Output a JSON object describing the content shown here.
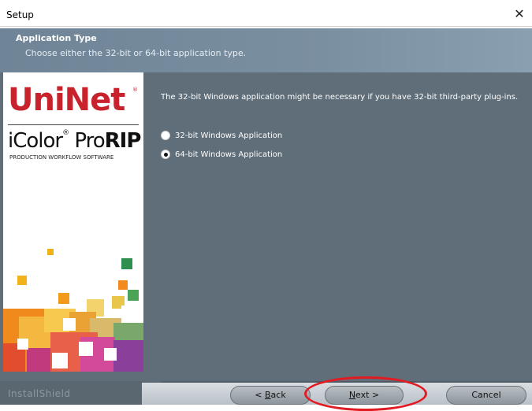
{
  "window": {
    "title": "Setup"
  },
  "header": {
    "title": "Application Type",
    "subtitle": "Choose either the 32-bit or 64-bit application type."
  },
  "side_logo": {
    "brand": "UniNet",
    "product_light": "iColor",
    "product_mid": "Pro",
    "product_bold": "RIP",
    "tagline": "PRODUCTION WORKFLOW SOFTWARE"
  },
  "content": {
    "description": "The 32-bit Windows application might be necessary if you have 32-bit third-party plug-ins.",
    "options": [
      {
        "label": "32-bit Windows Application",
        "selected": false
      },
      {
        "label": "64-bit Windows Application",
        "selected": true
      }
    ]
  },
  "footer": {
    "brand": "InstallShield",
    "back_prefix": "< ",
    "back_hot": "B",
    "back_rest": "ack",
    "next_hot": "N",
    "next_rest": "ext >",
    "cancel_label": "Cancel"
  },
  "colors": {
    "brand_red": "#c8232c",
    "panel": "#5f6e79",
    "highlight": "#e11b22"
  }
}
